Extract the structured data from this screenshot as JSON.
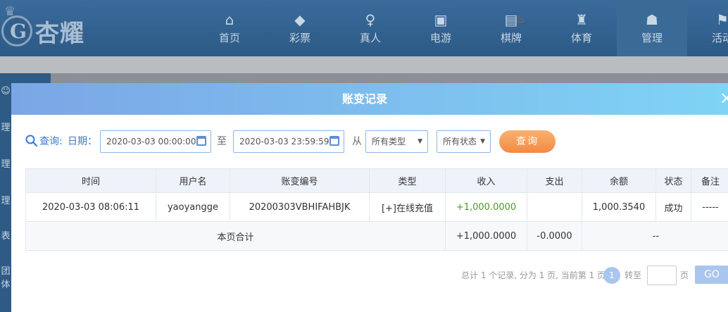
{
  "logo": {
    "name": "杏耀"
  },
  "nav": {
    "items": [
      {
        "label": "首页",
        "icon": "home-icon",
        "glyph": "⌂"
      },
      {
        "label": "彩票",
        "icon": "lottery-icon",
        "glyph": "◆"
      },
      {
        "label": "真人",
        "icon": "live-dealer-icon",
        "glyph": "♀"
      },
      {
        "label": "电游",
        "icon": "slot-game-icon",
        "glyph": "▣"
      },
      {
        "label": "棋牌",
        "icon": "cards-icon",
        "glyph": "▤"
      },
      {
        "label": "体育",
        "icon": "trophy-icon",
        "glyph": "♜"
      },
      {
        "label": "管理",
        "icon": "users-icon",
        "glyph": "☗"
      },
      {
        "label": "活动",
        "icon": "activity-icon",
        "glyph": "⚑"
      }
    ],
    "hot_glyph": "♨"
  },
  "side_rail": {
    "items": [
      "☺",
      "理",
      "理",
      "理",
      "表",
      "团体"
    ]
  },
  "modal": {
    "title": "账变记录",
    "close": "×"
  },
  "filters": {
    "query_label": "查询:",
    "date_label": "日期：",
    "start": "2020-03-03 00:00:00",
    "to_label": "至",
    "end": "2020-03-03 23:59:59",
    "from_label": "从",
    "type_select": "所有类型",
    "status_select": "所有状态",
    "query_button": "查询"
  },
  "table": {
    "headers": [
      "时间",
      "用户名",
      "账变编号",
      "类型",
      "收入",
      "支出",
      "余额",
      "状态",
      "备注"
    ],
    "rows": [
      {
        "time": "2020-03-03 08:06:11",
        "user": "yaoyangge",
        "no": "20200303VBHIFAHBJK",
        "type": "[+]在线充值",
        "income": "+1,000.0000",
        "expense": "",
        "balance": "1,000.3540",
        "status": "成功",
        "note": "-----"
      }
    ],
    "summary": {
      "label": "本页合计",
      "income": "+1,000.0000",
      "expense": "-0.0000",
      "rest": "--"
    }
  },
  "pager": {
    "info": "总计 1 个记录, 分为 1 页, 当前第 1 页",
    "current": "1",
    "goto_label": "转至",
    "page_label": "页",
    "go": "GO"
  },
  "colors": {
    "nav_bg": "#2f5f8e",
    "modal_head_start": "#7ba6e6",
    "modal_head_end": "#7fd4f5",
    "accent_blue": "#3a7bd5",
    "button_orange": "#f18a43",
    "income_green": "#4a9a2c"
  }
}
